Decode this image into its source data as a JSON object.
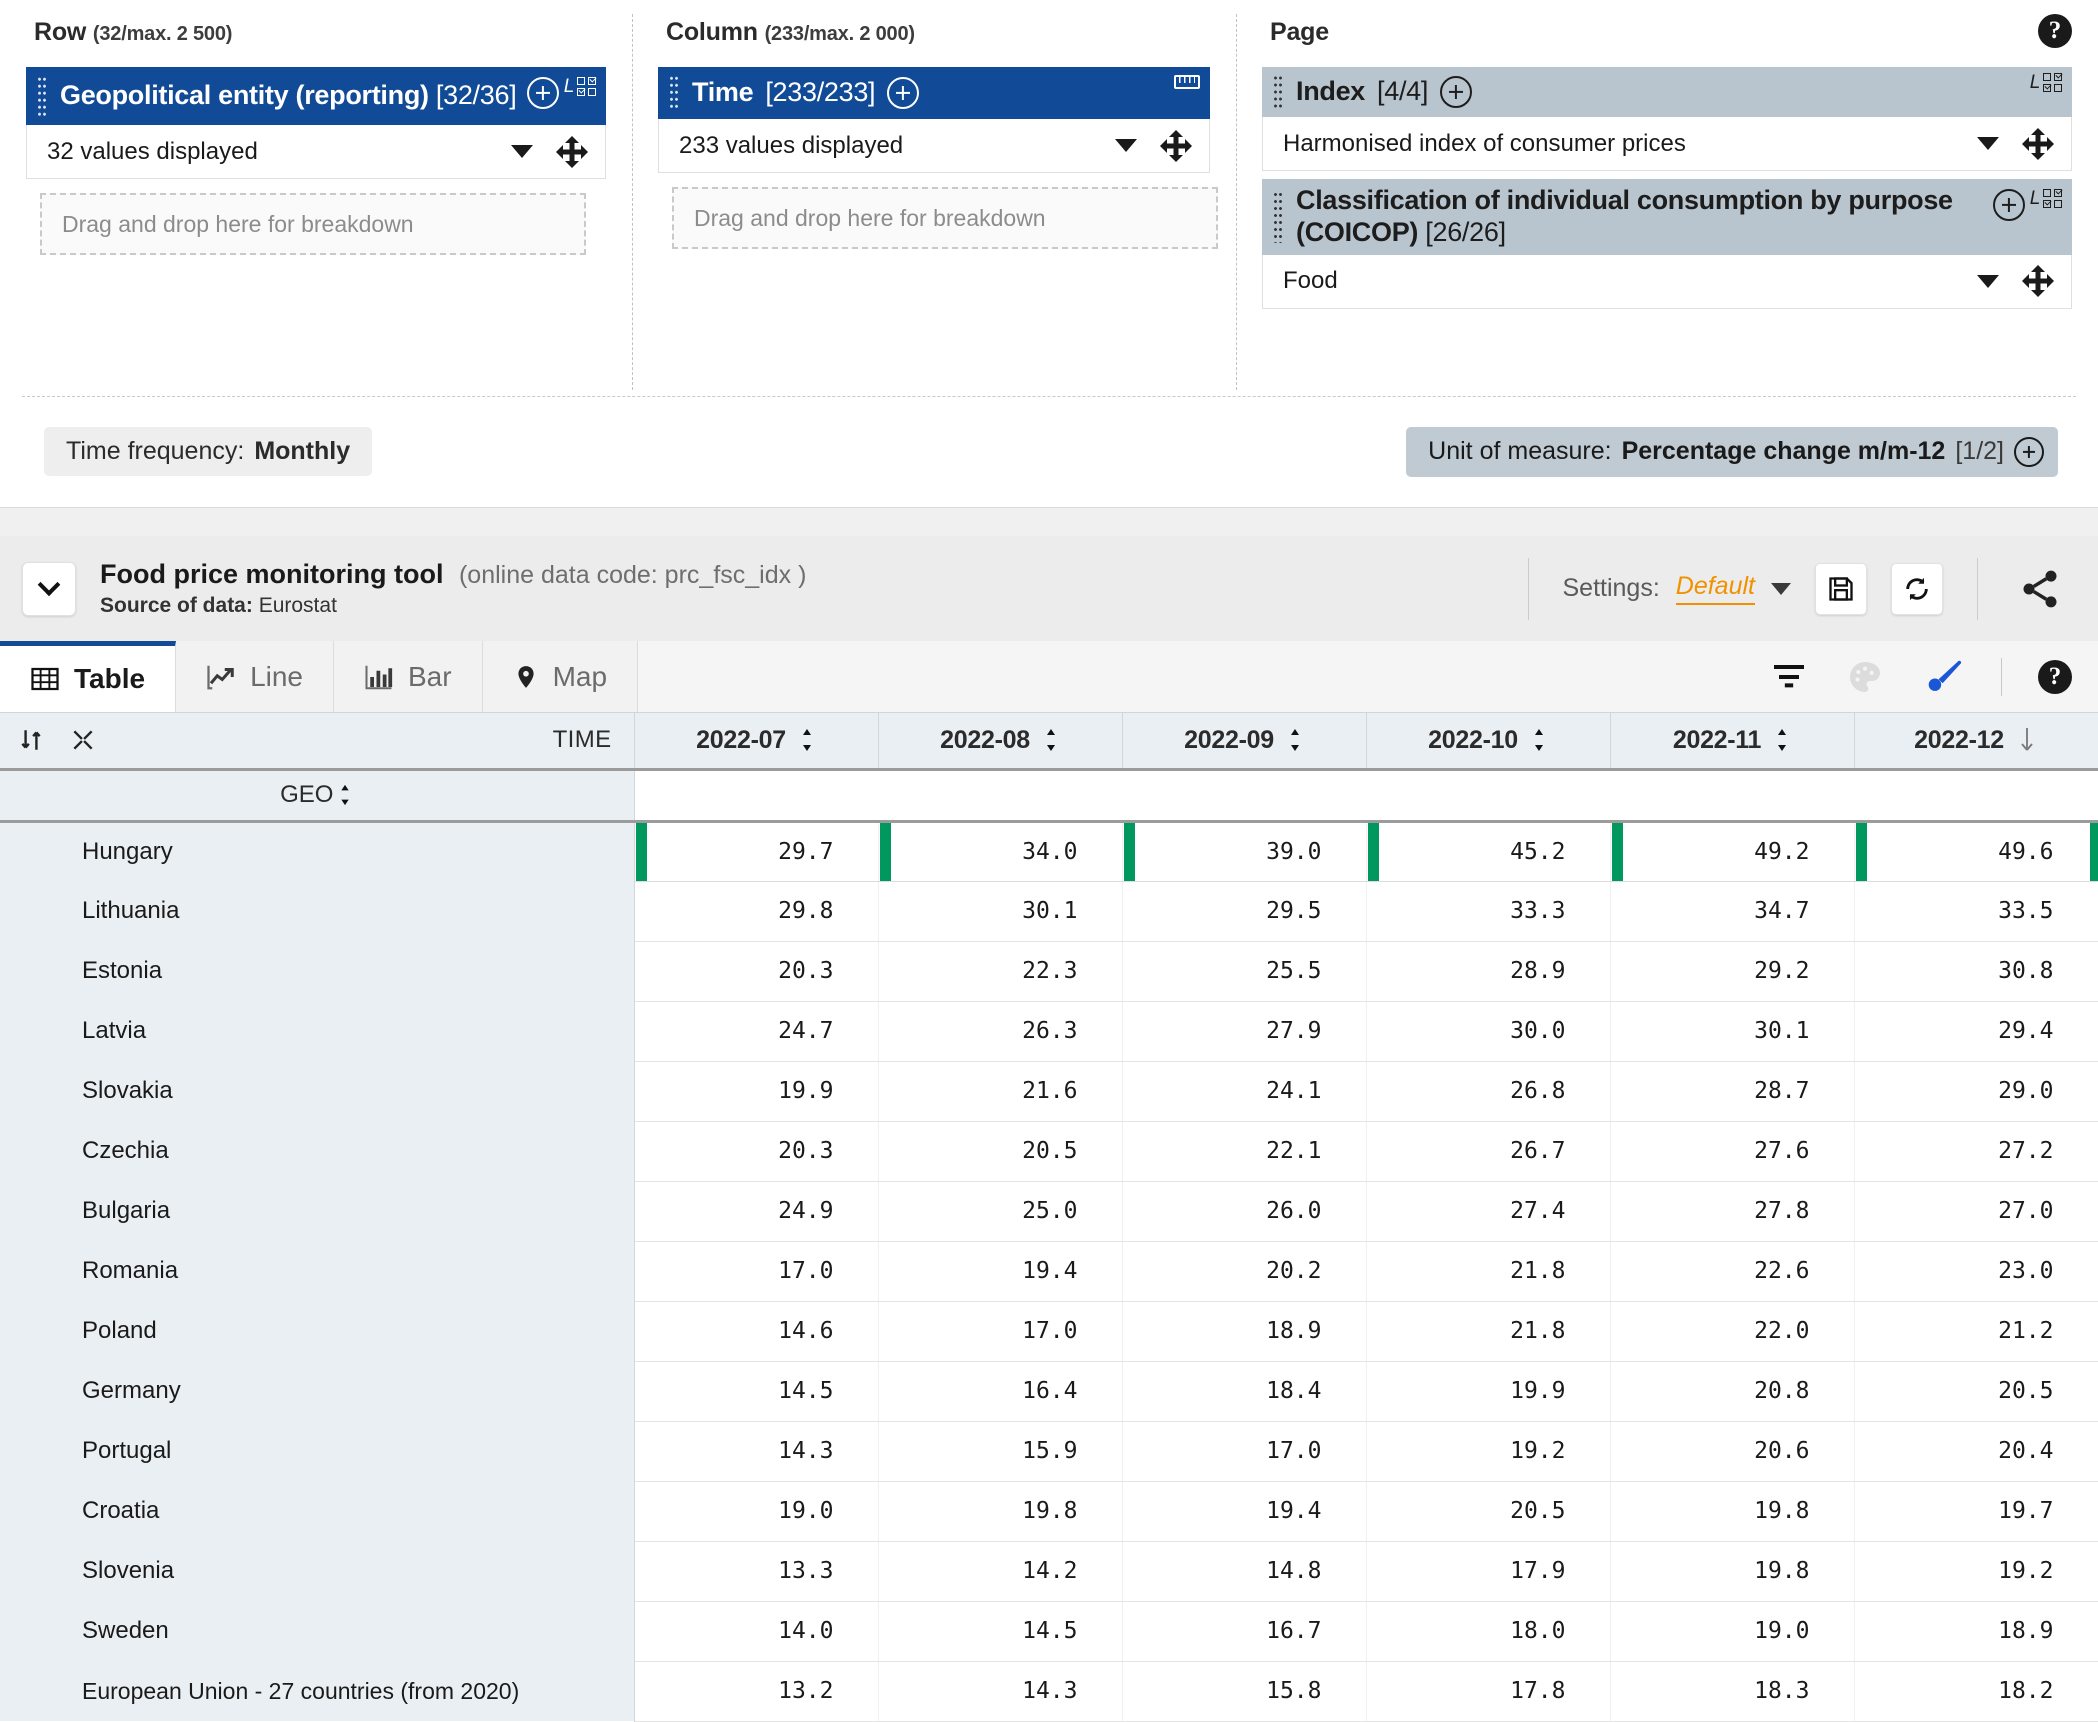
{
  "selector": {
    "row": {
      "heading": "Row",
      "heading_caption": "(32/max. 2 500)",
      "dimension_title": "Geopolitical entity (reporting)",
      "dimension_count": "[32/36]",
      "value_text": "32 values displayed",
      "dropzone_text": "Drag and drop here for breakdown"
    },
    "column": {
      "heading": "Column",
      "heading_caption": "(233/max. 2 000)",
      "dimension_title": "Time",
      "dimension_count": "[233/233]",
      "value_text": "233 values displayed",
      "dropzone_text": "Drag and drop here for breakdown"
    },
    "page": {
      "heading": "Page",
      "index": {
        "dimension_title": "Index",
        "dimension_count": "[4/4]",
        "value_text": "Harmonised index of consumer prices"
      },
      "coicop": {
        "dimension_title": "Classification of individual consumption by purpose (COICOP)",
        "dimension_count": "[26/26]",
        "value_text": "Food"
      }
    },
    "time_frequency": {
      "label": "Time frequency:",
      "value": "Monthly"
    },
    "unit_of_measure": {
      "label": "Unit of measure:",
      "value": "Percentage change m/m-12",
      "count": "[1/2]"
    }
  },
  "tool": {
    "title": "Food price monitoring tool",
    "code": "(online data code: prc_fsc_idx )",
    "source_label": "Source of data:",
    "source_value": "Eurostat",
    "settings_label": "Settings:",
    "settings_value": "Default",
    "tabs": [
      {
        "label": "Table",
        "icon": "table-icon",
        "active": true
      },
      {
        "label": "Line",
        "icon": "line-chart-icon",
        "active": false
      },
      {
        "label": "Bar",
        "icon": "bar-chart-icon",
        "active": false
      },
      {
        "label": "Map",
        "icon": "map-pin-icon",
        "active": false
      }
    ]
  },
  "colors": {
    "dimension_active": "#114a96",
    "dimension_page": "#b9c5ce",
    "highlight_green": "#00985f",
    "settings_accent": "#f29100"
  },
  "chart_data": {
    "type": "table",
    "title": "Food price monitoring tool",
    "row_header": "GEO",
    "column_header": "TIME",
    "categories": [
      "2022-07",
      "2022-08",
      "2022-09",
      "2022-10",
      "2022-11",
      "2022-12"
    ],
    "sorted_by": "2022-12",
    "sort_direction": "descending",
    "unit": "Percentage change m/m-12",
    "highlighted_row": "Hungary",
    "rows": [
      {
        "geo": "Hungary",
        "values": [
          29.7,
          34.0,
          39.0,
          45.2,
          49.2,
          49.6
        ]
      },
      {
        "geo": "Lithuania",
        "values": [
          29.8,
          30.1,
          29.5,
          33.3,
          34.7,
          33.5
        ]
      },
      {
        "geo": "Estonia",
        "values": [
          20.3,
          22.3,
          25.5,
          28.9,
          29.2,
          30.8
        ]
      },
      {
        "geo": "Latvia",
        "values": [
          24.7,
          26.3,
          27.9,
          30.0,
          30.1,
          29.4
        ]
      },
      {
        "geo": "Slovakia",
        "values": [
          19.9,
          21.6,
          24.1,
          26.8,
          28.7,
          29.0
        ]
      },
      {
        "geo": "Czechia",
        "values": [
          20.3,
          20.5,
          22.1,
          26.7,
          27.6,
          27.2
        ]
      },
      {
        "geo": "Bulgaria",
        "values": [
          24.9,
          25.0,
          26.0,
          27.4,
          27.8,
          27.0
        ]
      },
      {
        "geo": "Romania",
        "values": [
          17.0,
          19.4,
          20.2,
          21.8,
          22.6,
          23.0
        ]
      },
      {
        "geo": "Poland",
        "values": [
          14.6,
          17.0,
          18.9,
          21.8,
          22.0,
          21.2
        ]
      },
      {
        "geo": "Germany",
        "values": [
          14.5,
          16.4,
          18.4,
          19.9,
          20.8,
          20.5
        ]
      },
      {
        "geo": "Portugal",
        "values": [
          14.3,
          15.9,
          17.0,
          19.2,
          20.6,
          20.4
        ]
      },
      {
        "geo": "Croatia",
        "values": [
          19.0,
          19.8,
          19.4,
          20.5,
          19.8,
          19.7
        ]
      },
      {
        "geo": "Slovenia",
        "values": [
          13.3,
          14.2,
          14.8,
          17.9,
          19.8,
          19.2
        ]
      },
      {
        "geo": "Sweden",
        "values": [
          14.0,
          14.5,
          16.7,
          18.0,
          19.0,
          18.9
        ]
      },
      {
        "geo": "European Union - 27 countries (from 2020)",
        "values": [
          13.2,
          14.3,
          15.8,
          17.8,
          18.3,
          18.2
        ]
      }
    ]
  }
}
